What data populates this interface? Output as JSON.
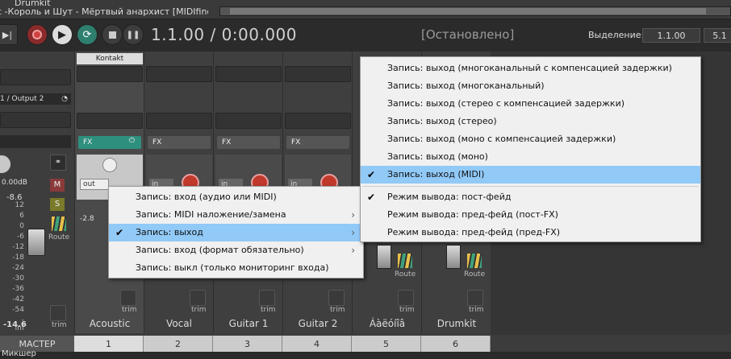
{
  "titlebar": {
    "left_text": "Drumkit",
    "project_title": "с -Король и Шут - Мёртвый анархист [MIDIfind.com].mi"
  },
  "transport": {
    "time": "1.1.00 / 0:00.000",
    "status": "[Остановлено]",
    "selection_label": "Выделение:",
    "selection_start": "1.1.00",
    "selection_end": "5.1"
  },
  "mixer": {
    "output_label": "1 / Output 2",
    "master": {
      "db_top": "0.00dB",
      "peak": "-8.6",
      "level": "-14.6",
      "route": "Route",
      "trim": "trim",
      "name": "МАСТЕР",
      "m": "M",
      "s": "S"
    },
    "channels": [
      {
        "name": "Acoustic",
        "num": "1",
        "plugin": "Kontakt",
        "fx": "FX",
        "io": "out",
        "peak": "-2.8",
        "trim": "trim"
      },
      {
        "name": "Vocal",
        "num": "2",
        "fx": "FX",
        "io": "in",
        "trim": "trim"
      },
      {
        "name": "Guitar 1",
        "num": "3",
        "fx": "FX",
        "io": "in",
        "trim": "trim"
      },
      {
        "name": "Guitar 2",
        "num": "4",
        "fx": "FX",
        "io": "in",
        "trim": "trim"
      },
      {
        "name": "Áàëóíîâ",
        "num": "5",
        "route": "Route",
        "trim": "trim"
      },
      {
        "name": "Drumkit",
        "num": "6",
        "route": "Route",
        "trim": "trim"
      }
    ],
    "scale": [
      "12",
      "6",
      "0",
      "-6",
      "-12",
      "-18",
      "-24",
      "-30",
      "-36",
      "-42",
      "-54",
      "-inf"
    ],
    "scale2": [
      "-6",
      "-12",
      "-18",
      "-24",
      "-30",
      "-36",
      "-42",
      "-54"
    ],
    "bottom_tab": "Микшер"
  },
  "menu1": {
    "items": [
      {
        "label": "Запись: вход (аудио или MIDI)",
        "checked": false,
        "submenu": false
      },
      {
        "label": "Запись: MIDI наложение/замена",
        "checked": false,
        "submenu": true
      },
      {
        "label": "Запись: выход",
        "checked": true,
        "submenu": true,
        "highlighted": true
      },
      {
        "label": "Запись: вход (формат обязательно)",
        "checked": false,
        "submenu": true
      },
      {
        "label": "Запись: выкл (только мониторинг входа)",
        "checked": false,
        "submenu": false
      }
    ]
  },
  "menu2": {
    "items": [
      {
        "label": "Запись: выход (многоканальный с компенсацией задержки)"
      },
      {
        "label": "Запись: выход (многоканальный)"
      },
      {
        "label": "Запись: выход (стерео с компенсацией задержки)"
      },
      {
        "label": "Запись: выход (стерео)"
      },
      {
        "label": "Запись: выход (моно с компенсацией задержки)"
      },
      {
        "label": "Запись: выход (моно)"
      },
      {
        "label": "Запись: выход (MIDI)",
        "checked": true,
        "highlighted": true
      }
    ],
    "items2": [
      {
        "label": "Режим вывода: пост-фейд",
        "checked": true
      },
      {
        "label": "Режим вывода: пред-фейд (пост-FX)"
      },
      {
        "label": "Режим вывода: пред-фейд (пред-FX)"
      }
    ]
  },
  "colors": {
    "accent": "#91c9f7",
    "fx_active": "#2e8f7e",
    "record": "#c0392b"
  }
}
